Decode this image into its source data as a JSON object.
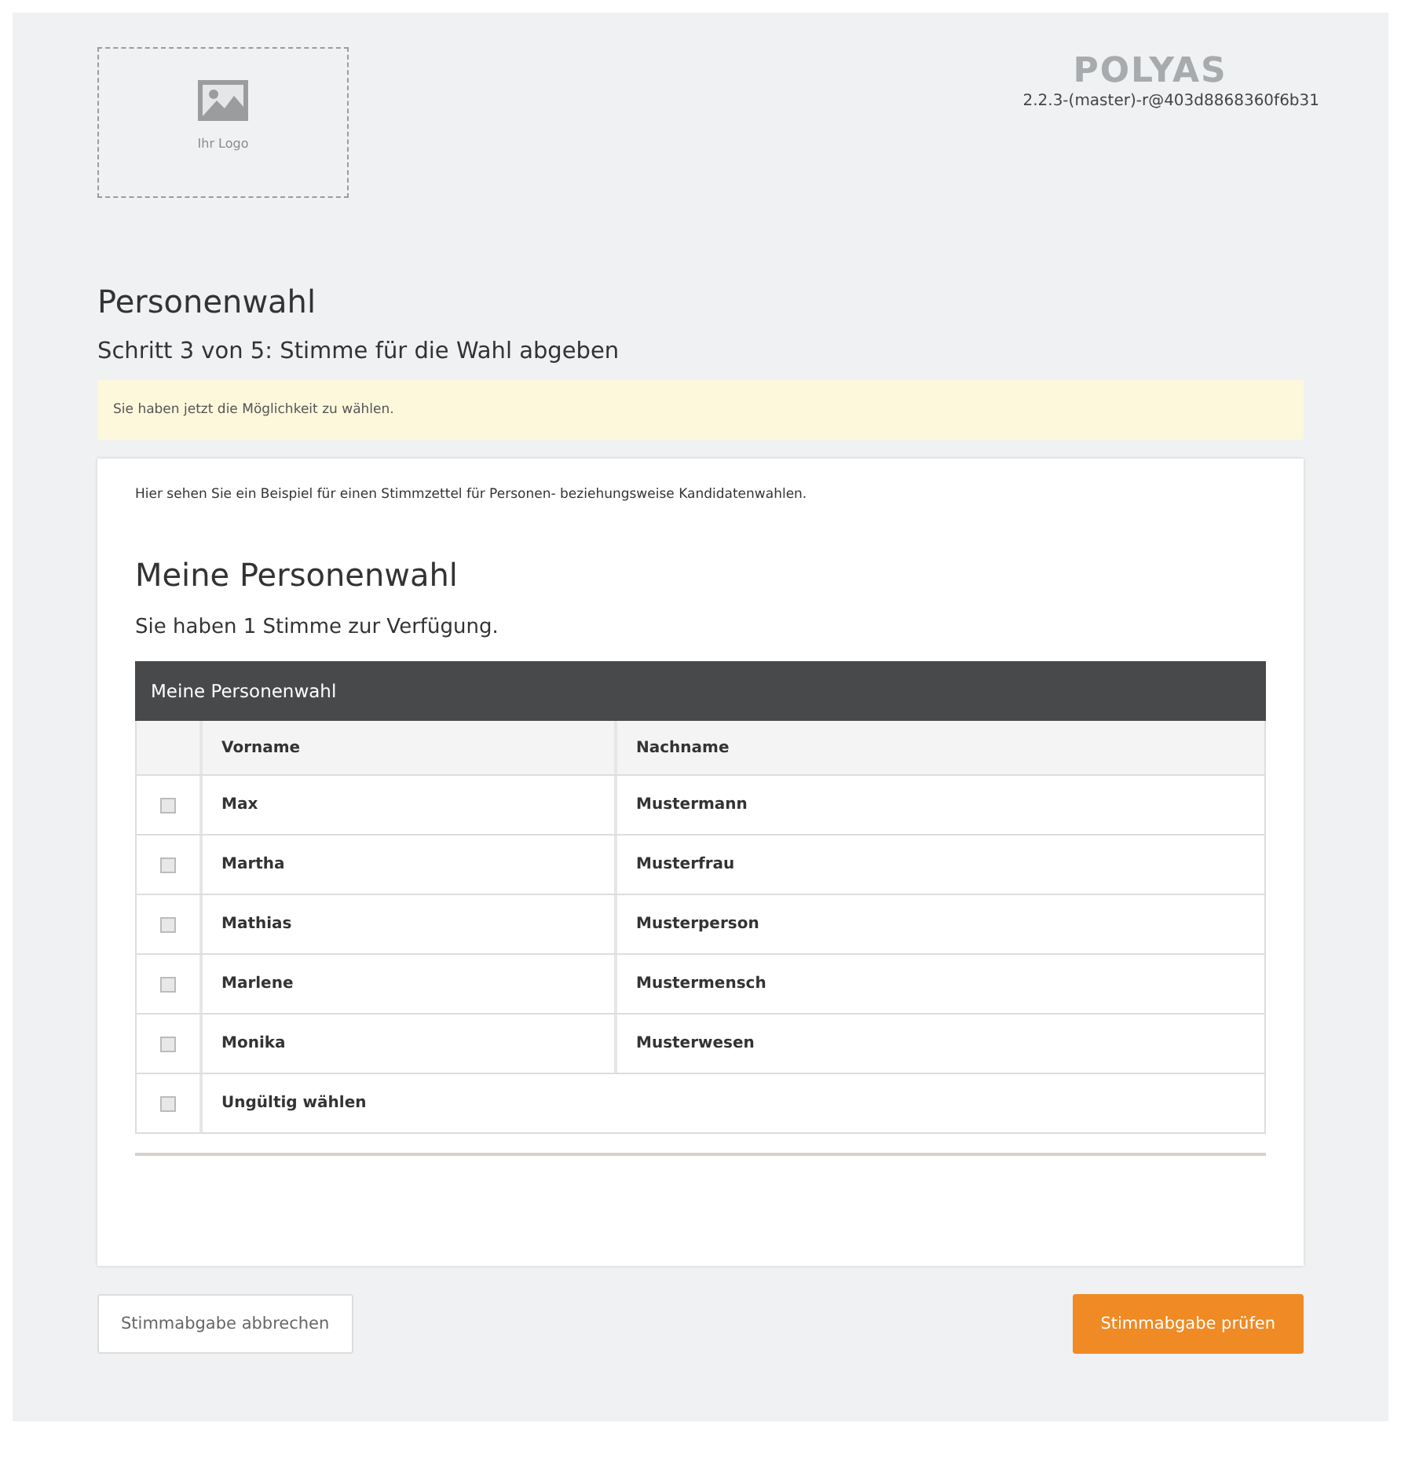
{
  "logo_placeholder": {
    "label": "Ihr Logo"
  },
  "brand": {
    "name": "POLYAS",
    "version": "2.2.3-(master)-r@403d8868360f6b31"
  },
  "page_title": "Personenwahl",
  "step": "Schritt 3 von 5: Stimme für die Wahl abgeben",
  "notice": "Sie haben jetzt die Möglichkeit zu wählen.",
  "intro": "Hier sehen Sie ein Beispiel für einen Stimmzettel für Personen- beziehungsweise Kandidatenwahlen.",
  "ballot": {
    "title": "Meine Personenwahl",
    "votes_info": "Sie haben 1 Stimme zur Verfügung.",
    "table": {
      "title": "Meine Personenwahl",
      "columns": [
        "Vorname",
        "Nachname"
      ],
      "rows": [
        {
          "kind": "candidate",
          "cells": [
            "Max",
            "Mustermann"
          ],
          "checked": false
        },
        {
          "kind": "candidate",
          "cells": [
            "Martha",
            "Musterfrau"
          ],
          "checked": false
        },
        {
          "kind": "candidate",
          "cells": [
            "Mathias",
            "Musterperson"
          ],
          "checked": false
        },
        {
          "kind": "candidate",
          "cells": [
            "Marlene",
            "Mustermensch"
          ],
          "checked": false
        },
        {
          "kind": "candidate",
          "cells": [
            "Monika",
            "Musterwesen"
          ],
          "checked": false
        },
        {
          "kind": "invalid",
          "cells": [
            "Ungültig wählen"
          ],
          "checked": false
        }
      ]
    }
  },
  "buttons": [
    {
      "kind": "secondary",
      "label": "Stimmabgabe abbrechen"
    },
    {
      "kind": "primary",
      "label": "Stimmabgabe prüfen"
    }
  ]
}
